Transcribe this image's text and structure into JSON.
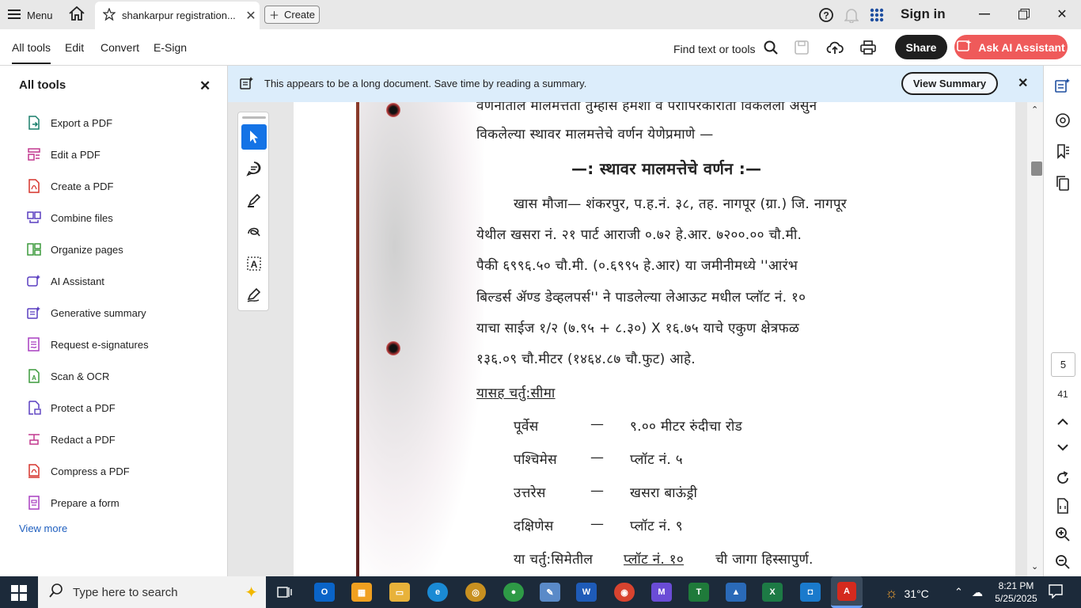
{
  "titlebar": {
    "menu_label": "Menu",
    "tab_title": "shankarpur registration...",
    "create_label": "Create",
    "sign_in": "Sign in"
  },
  "toolbar": {
    "tabs": [
      "All tools",
      "Edit",
      "Convert",
      "E-Sign"
    ],
    "find_label": "Find text or tools",
    "share_label": "Share",
    "ai_label": "Ask AI Assistant"
  },
  "left_panel": {
    "title": "All tools",
    "items": [
      {
        "label": "Export a PDF",
        "icon": "export-pdf-icon"
      },
      {
        "label": "Edit a PDF",
        "icon": "edit-pdf-icon"
      },
      {
        "label": "Create a PDF",
        "icon": "create-pdf-icon"
      },
      {
        "label": "Combine files",
        "icon": "combine-files-icon"
      },
      {
        "label": "Organize pages",
        "icon": "organize-pages-icon"
      },
      {
        "label": "AI Assistant",
        "icon": "ai-assistant-icon"
      },
      {
        "label": "Generative summary",
        "icon": "generative-summary-icon"
      },
      {
        "label": "Request e-signatures",
        "icon": "request-esign-icon"
      },
      {
        "label": "Scan & OCR",
        "icon": "scan-ocr-icon"
      },
      {
        "label": "Protect a PDF",
        "icon": "protect-pdf-icon"
      },
      {
        "label": "Redact a PDF",
        "icon": "redact-pdf-icon"
      },
      {
        "label": "Compress a PDF",
        "icon": "compress-pdf-icon"
      },
      {
        "label": "Prepare a form",
        "icon": "prepare-form-icon"
      }
    ],
    "view_more": "View more"
  },
  "banner": {
    "text": "This appears to be a long document. Save time by reading a summary.",
    "button": "View Summary"
  },
  "document": {
    "line_partial_top": "वणनातील मालमत्तता तुम्हास हमशा व पराापरकाराता विकलला असुन",
    "line_1": "विकलेल्या स्थावर मालमत्तेचे वर्णन येणेप्रमाणे —",
    "heading": "—: स्थावर मालमत्तेचे वर्णन :—",
    "para": [
      "खास मौजा— शंकरपुर, प.ह.नं. ३८, तह. नागपूर (ग्रा.) जि. नागपूर",
      "येथील खसरा नं. २१ पार्ट आराजी ०.७२ हे.आर. ७२००.०० चौ.मी.",
      "पैकी ६९९६.५० चौ.मी. (०.६९९५ हे.आर) या जमीनीमध्ये ''आरंभ",
      "बिल्डर्स ॲण्ड डेव्हलपर्स'' ने पाडलेल्या लेआऊट मधील प्लॉट नं. १०",
      "याचा साईज १/२ (७.९५ + ८.३०) X १६.७५ याचे एकुण क्षेत्रफळ",
      "१३६.०९ चौ.मीटर (१४६४.८७ चौ.फुट) आहे."
    ],
    "boundary_heading": "यासह चर्तु:सीमा",
    "boundaries": [
      {
        "side": "पूर्वेस",
        "dash": "—",
        "value": "९.०० मीटर रुंदीचा रोड"
      },
      {
        "side": "पश्चिमेस",
        "dash": "—",
        "value": "प्लॉट नं. ५"
      },
      {
        "side": "उत्तरेस",
        "dash": "—",
        "value": "खसरा बाऊंड्री"
      },
      {
        "side": "दक्षिणेस",
        "dash": "—",
        "value": "प्लॉट नं. ९"
      }
    ],
    "closing_a": "या चर्तु:सिमेतील",
    "closing_b": "प्लॉट नं. १०",
    "closing_c": "ची जागा हिस्सापुर्ण."
  },
  "page_nav": {
    "current": "5",
    "total": "41"
  },
  "taskbar": {
    "search_placeholder": "Type here to search",
    "temperature": "31°C",
    "time": "8:21 PM",
    "date": "5/25/2025"
  },
  "colors": {
    "accent": "#1473e6",
    "ai_button": "#ef5a5a",
    "banner_bg": "#dcedfb",
    "taskbar": "#1c2a3a"
  }
}
